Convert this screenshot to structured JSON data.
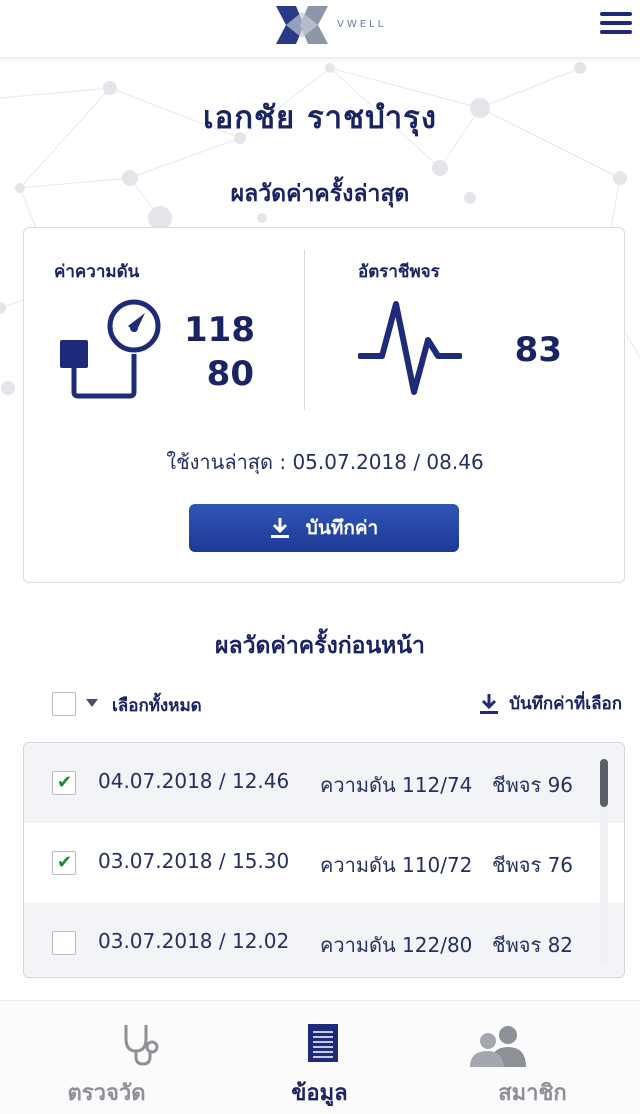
{
  "header": {
    "logo_text": "VWELL",
    "menu_icon": "hamburger-menu-icon"
  },
  "user": {
    "name": "เอกชัย  ราชบำรุง"
  },
  "latest": {
    "title": "ผลวัดค่าครั้งล่าสุด",
    "bp_label": "ค่าความดัน",
    "bp_systolic": "118",
    "bp_diastolic": "80",
    "hr_label": "อัตราชีพจร",
    "hr_value": "83",
    "last_used": "ใช้งานล่าสุด : 05.07.2018 / 08.46",
    "save_button": "บันทึกค่า"
  },
  "history": {
    "title": "ผลวัดค่าครั้งก่อนหน้า",
    "select_all": "เลือกทั้งหมด",
    "save_selected": "บันทึกค่าที่เลือก",
    "rows": [
      {
        "checked": true,
        "datetime": "04.07.2018 / 12.46",
        "pressure": "ความดัน 112/74",
        "pulse": "ชีพจร 96"
      },
      {
        "checked": true,
        "datetime": "03.07.2018 / 15.30",
        "pressure": "ความดัน 110/72",
        "pulse": "ชีพจร 76"
      },
      {
        "checked": false,
        "datetime": "03.07.2018 / 12.02",
        "pressure": "ความดัน 122/80",
        "pulse": "ชีพจร 82"
      }
    ]
  },
  "nav": {
    "items": [
      {
        "label": "ตรวจวัด",
        "icon": "stethoscope-icon",
        "active": false
      },
      {
        "label": "ข้อมูล",
        "icon": "document-list-icon",
        "active": true
      },
      {
        "label": "สมาชิก",
        "icon": "members-icon",
        "active": false
      }
    ]
  },
  "colors": {
    "primary": "#1b2462",
    "button": "#2447a8",
    "check": "#1f8a2e",
    "nav_inactive": "#8d9096"
  }
}
